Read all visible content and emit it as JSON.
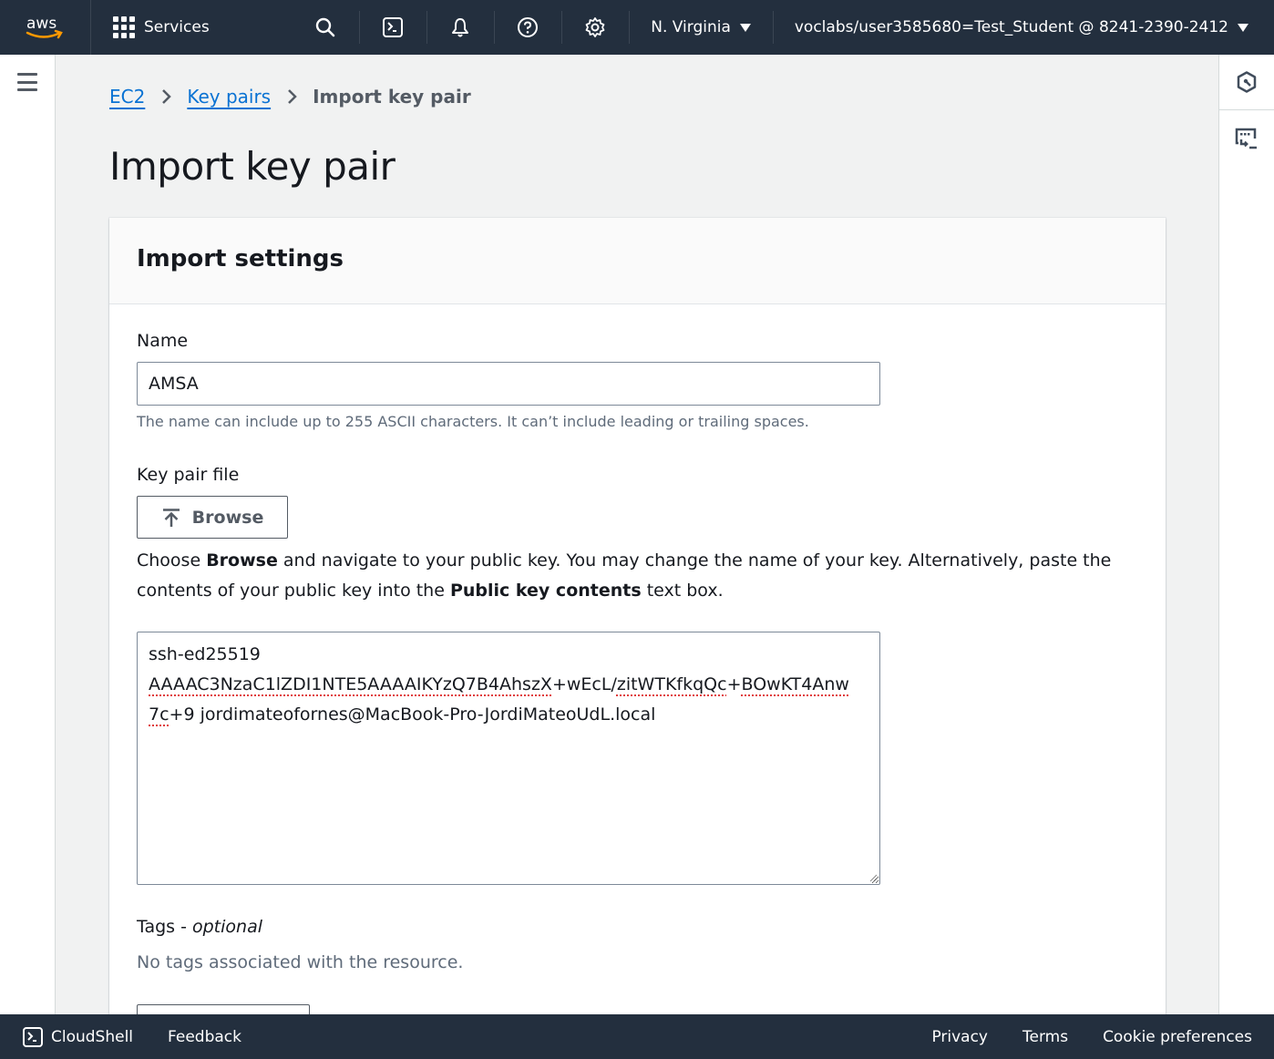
{
  "topnav": {
    "logo": "aws",
    "services_label": "Services",
    "icons": [
      "search-icon",
      "cloudshell-icon",
      "notifications-icon",
      "help-icon",
      "settings-icon"
    ],
    "region": "N. Virginia",
    "account": "voclabs/user3585680=Test_Student @ 8241-2390-2412"
  },
  "breadcrumb": {
    "items": [
      "EC2",
      "Key pairs"
    ],
    "current": "Import key pair"
  },
  "page": {
    "title": "Import key pair"
  },
  "panel": {
    "title": "Import settings",
    "name": {
      "label": "Name",
      "value": "AMSA",
      "hint": "The name can include up to 255 ASCII characters. It can’t include leading or trailing spaces."
    },
    "key_pair_file": {
      "label": "Key pair file",
      "browse_label": "Browse",
      "desc_part1": "Choose ",
      "desc_bold1": "Browse",
      "desc_part2": " and navigate to your public key. You may change the name of your key. Alternatively, paste the contents of your public key into the ",
      "desc_bold2": "Public key contents",
      "desc_part3": " text box."
    },
    "public_key": {
      "line1": "ssh-ed25519",
      "line2a": "AAAAC3NzaC1lZDI1NTE5AAAAIKYzQ7B4AhszX",
      "line2b": "+wEcL/",
      "line2c": "zitWTKfkqQc",
      "line2d": "+",
      "line2e": "BOwKT4Anw",
      "line3a": "7c",
      "line3b": "+9 jordimateofornes@MacBook-Pro-JordiMateoUdL.local"
    },
    "tags": {
      "label": "Tags - ",
      "label_italic": "optional",
      "empty": "No tags associated with the resource."
    }
  },
  "footer": {
    "cloudshell": "CloudShell",
    "feedback": "Feedback",
    "links": [
      "Privacy",
      "Terms",
      "Cookie preferences"
    ]
  },
  "colors": {
    "nav_bg": "#232f3e",
    "link": "#0972d3",
    "aws_orange": "#ff9900"
  }
}
